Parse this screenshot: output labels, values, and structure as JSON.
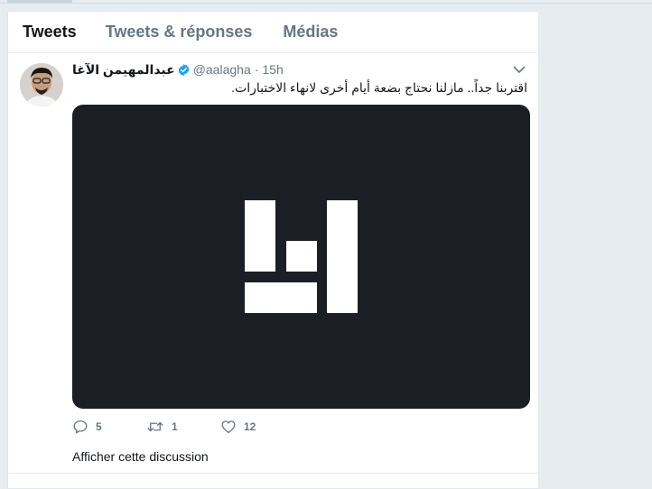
{
  "tabs": [
    {
      "label": "Tweets",
      "active": true
    },
    {
      "label": "Tweets & réponses",
      "active": false
    },
    {
      "label": "Médias",
      "active": false
    }
  ],
  "tweet": {
    "display_name": "عبدالمهيمن الآغا",
    "handle": "@aalagha",
    "separator": "·",
    "time": "15h",
    "text": "اقتربنا جداً.. مازلنا نحتاج بضعة أيام أخرى لانهاء الاختبارات.",
    "verified": true,
    "media_icon": "logo-icon",
    "replies": "5",
    "retweets": "1",
    "likes": "12",
    "show_thread": "Afficher cette discussion"
  },
  "colors": {
    "verified_badge": "#1da1f2",
    "media_background": "#1b1e25",
    "secondary_text": "#657786"
  }
}
